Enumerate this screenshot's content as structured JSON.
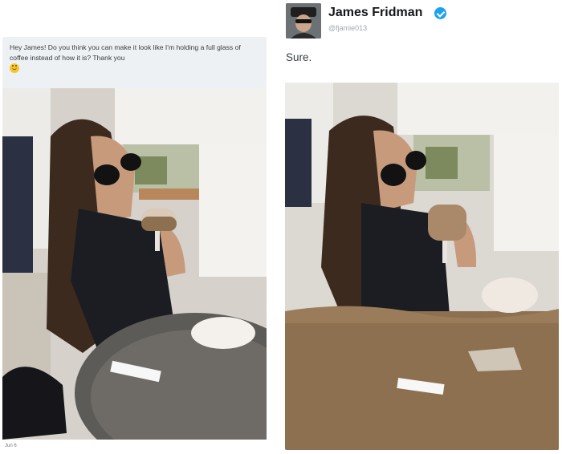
{
  "request": {
    "text": "Hey James! Do you think you can make it look like I'm holding a full glass of coffee instead of how it is? Thank you",
    "emoji": "smiling-face-emoji",
    "date": "Jun 6"
  },
  "response": {
    "name": "James Fridman",
    "handle": "@fjamie013",
    "text": "Sure.",
    "verified_color": "#1da1f2"
  },
  "colors": {
    "bubble_bg": "#eef1f4",
    "coffee": "#8c7050"
  }
}
